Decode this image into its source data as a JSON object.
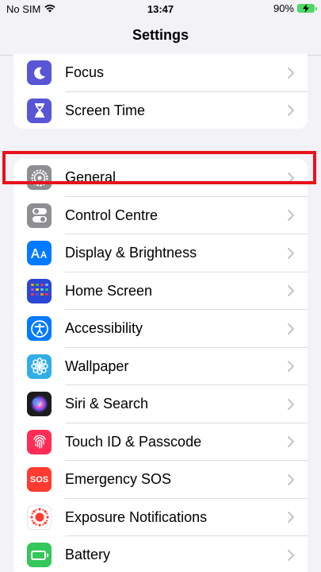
{
  "status": {
    "carrier": "No SIM",
    "time": "13:47",
    "battery": "90%"
  },
  "nav": {
    "title": "Settings"
  },
  "group1": [
    {
      "label": "Focus",
      "icon": "moon-icon",
      "color": "#5856d6"
    },
    {
      "label": "Screen Time",
      "icon": "hourglass-icon",
      "color": "#5856d6"
    }
  ],
  "group2": [
    {
      "label": "General",
      "icon": "gear-icon",
      "color": "#8e8e93"
    },
    {
      "label": "Control Centre",
      "icon": "toggles-icon",
      "color": "#8e8e93"
    },
    {
      "label": "Display & Brightness",
      "icon": "aa-icon",
      "color": "#007aff"
    },
    {
      "label": "Home Screen",
      "icon": "app-grid-icon",
      "color": "#2c46d6"
    },
    {
      "label": "Accessibility",
      "icon": "accessibility-icon",
      "color": "#007aff"
    },
    {
      "label": "Wallpaper",
      "icon": "flower-icon",
      "color": "#32ade6"
    },
    {
      "label": "Siri & Search",
      "icon": "siri-icon",
      "color": "#1c1c1e"
    },
    {
      "label": "Touch ID & Passcode",
      "icon": "fingerprint-icon",
      "color": "#ff2d55"
    },
    {
      "label": "Emergency SOS",
      "icon": "sos-icon",
      "color": "#ff3b30"
    },
    {
      "label": "Exposure Notifications",
      "icon": "exposure-icon",
      "color": "#ffffff"
    },
    {
      "label": "Battery",
      "icon": "battery-icon",
      "color": "#34c759"
    }
  ],
  "sos_text": "SOS"
}
